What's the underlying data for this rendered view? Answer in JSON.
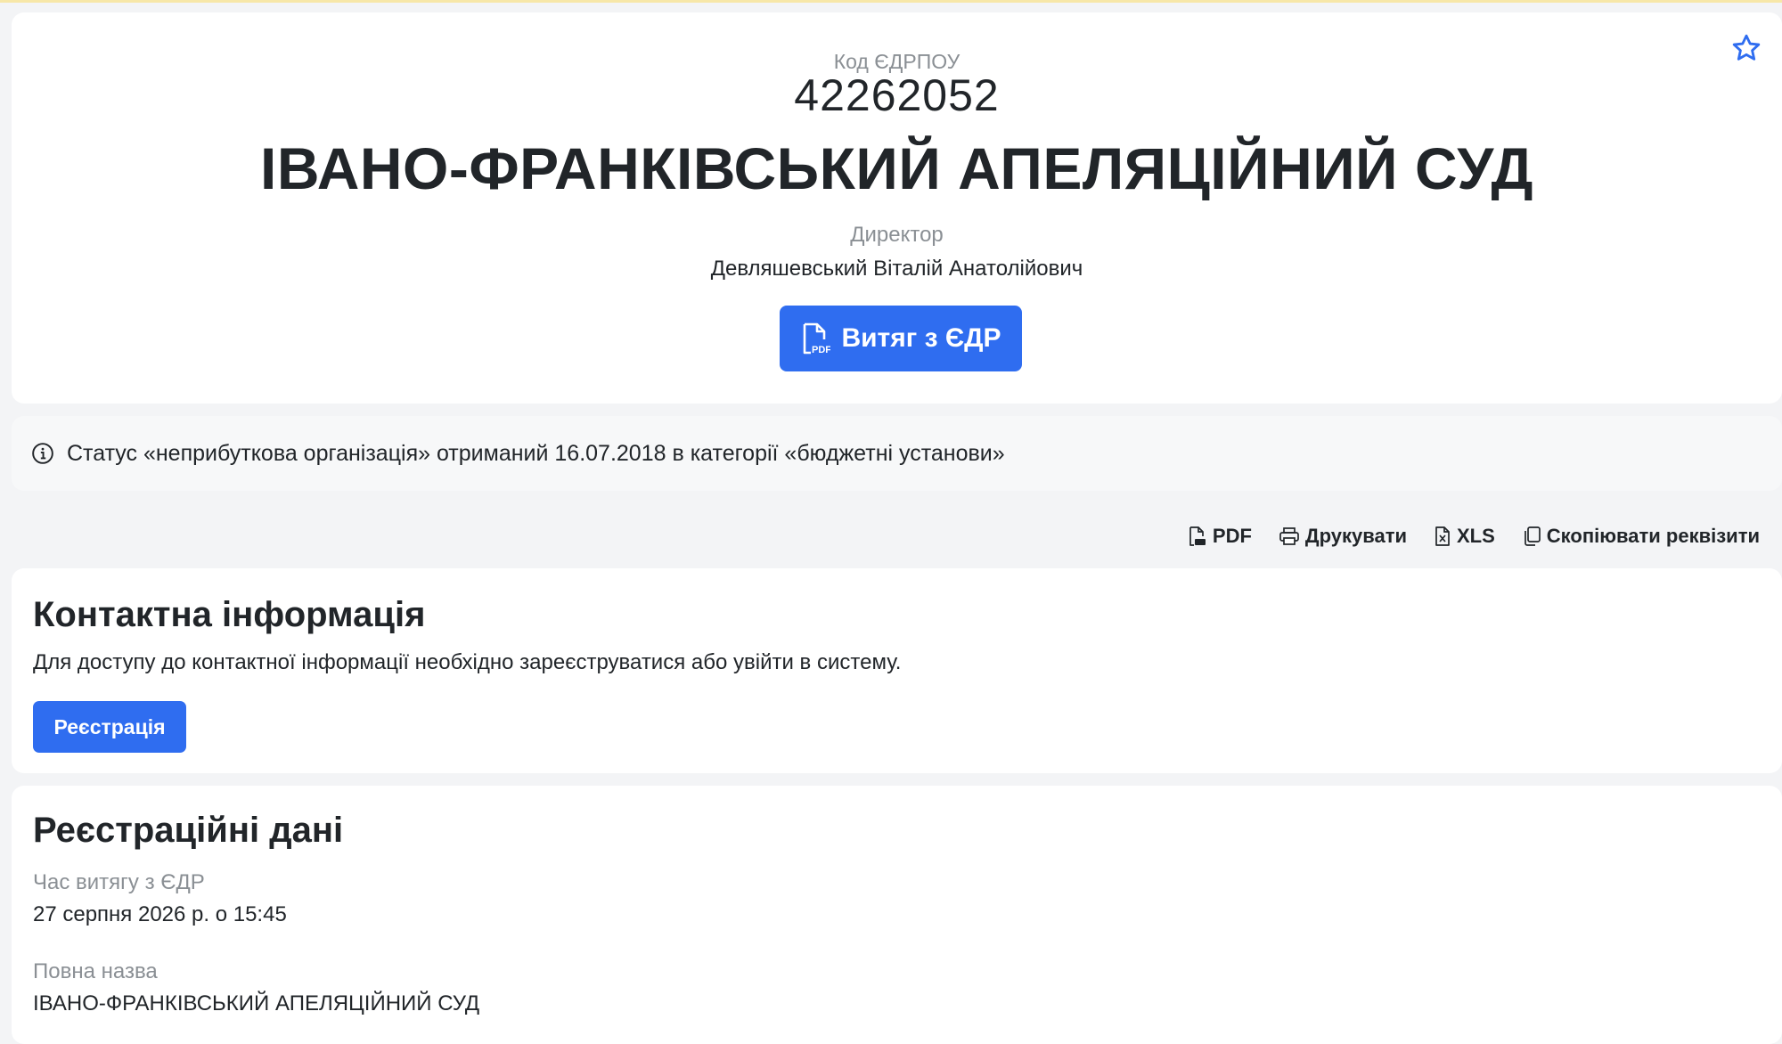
{
  "header": {
    "edrpou_label": "Код ЄДРПОУ",
    "edrpou_code": "42262052",
    "org_title": "ІВАНО-ФРАНКІВСЬКИЙ АПЕЛЯЦІЙНИЙ СУД",
    "director_label": "Директор",
    "director_name": "Девляшевський Віталій Анатолійович",
    "extract_button": "Витяг з ЄДР",
    "pdf_badge": "PDF"
  },
  "status": {
    "text": "Статус «неприбуткова організація» отриманий 16.07.2018 в категорії «бюджетні установи»"
  },
  "toolbar": {
    "pdf": "PDF",
    "print": "Друкувати",
    "xls": "XLS",
    "copy": "Скопіювати реквізити"
  },
  "contact": {
    "title": "Контактна інформація",
    "text": "Для доступу до контактної інформації необхідно зареєструватися або увійти в систему.",
    "register_button": "Реєстрація"
  },
  "registration": {
    "title": "Реєстраційні дані",
    "fields": [
      {
        "label": "Час витягу з ЄДР",
        "value": "27 серпня 2026 р. о 15:45"
      },
      {
        "label": "Повна назва",
        "value": "ІВАНО-ФРАНКІВСЬКИЙ АПЕЛЯЦІЙНИЙ СУД"
      }
    ]
  },
  "colors": {
    "accent": "#2f6df0",
    "muted_text": "#8a8f94",
    "page_bg": "#f3f4f6"
  }
}
